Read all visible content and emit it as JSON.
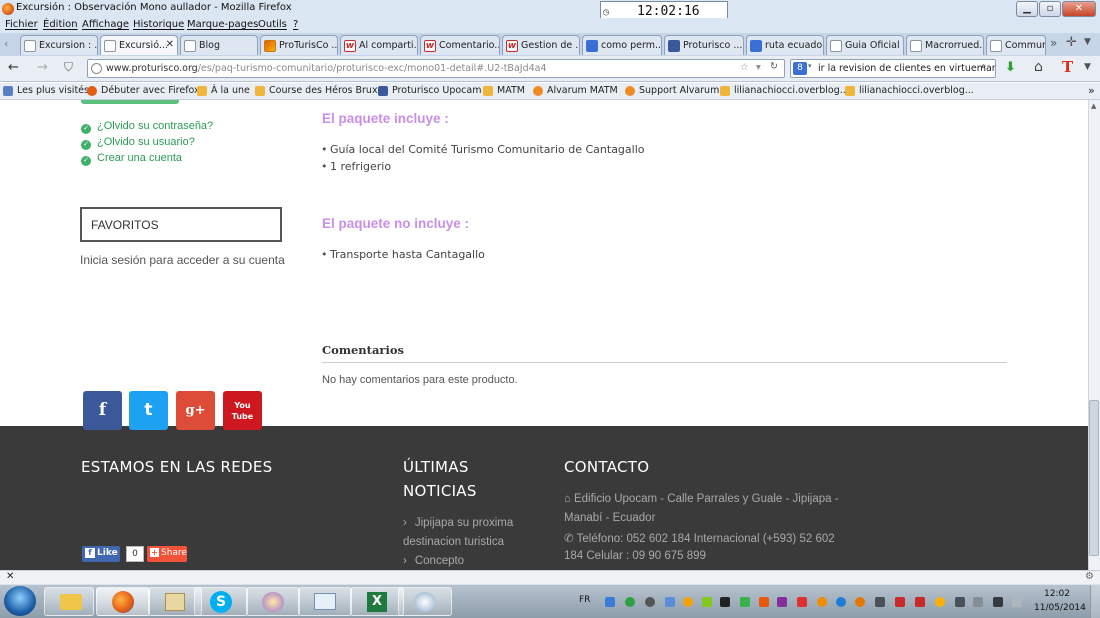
{
  "window": {
    "title": "Excursión : Observación Mono aullador - Mozilla Firefox",
    "clock": "12:02:16"
  },
  "menu": [
    "Fichier",
    "Édition",
    "Affichage",
    "Historique",
    "Marque-pages",
    "Outils",
    "?"
  ],
  "tabs": [
    {
      "label": "Excursion : ...",
      "icon": "page-icon"
    },
    {
      "label": "Excursió...",
      "icon": "page-icon",
      "active": true
    },
    {
      "label": "Blog",
      "icon": "page-icon"
    },
    {
      "label": "ProTurisCo ...",
      "icon": "proturisco-icon"
    },
    {
      "label": "Al comparti...",
      "icon": "w-icon"
    },
    {
      "label": "Comentario...",
      "icon": "w-icon"
    },
    {
      "label": "Gestion de ...",
      "icon": "w-icon"
    },
    {
      "label": "como perm...",
      "icon": "google-icon"
    },
    {
      "label": "Proturisco ...",
      "icon": "facebook-icon"
    },
    {
      "label": "ruta ecuado...",
      "icon": "google-icon"
    },
    {
      "label": "Guia Oficial ...",
      "icon": "page-icon"
    },
    {
      "label": "Macrorrued...",
      "icon": "page-icon"
    },
    {
      "label": "Communi...",
      "icon": "page-icon"
    }
  ],
  "nav": {
    "url_host": "www.proturisco.org",
    "url_path": "/es/paq-turismo-comunitario/proturisco-exc/mono01-detail#.U2-tBaJd4a4",
    "search": "ir la revision de clientes en virtuemart"
  },
  "bookmarks": [
    "Les plus visités",
    "Débuter avec Firefox",
    "À la une",
    "Course des Héros Brux...",
    "Proturisco Upocam",
    "MATM",
    "Alvarum MATM",
    "Support Alvarum",
    "lilianachiocci.overblog...",
    "lilianachiocci.overblog..."
  ],
  "sidebar": {
    "links": [
      "¿Olvido su contraseña?",
      "¿Olvido su usuario?",
      "Crear una cuenta"
    ],
    "favorites_title": "FAVORITOS",
    "favorites_text": "Inicia sesión para acceder a su cuenta"
  },
  "main": {
    "includes_title": "El paquete incluye :",
    "includes": [
      "Guía local del Comité Turismo Comunitario de Cantagallo",
      "1 refrigerio"
    ],
    "excludes_title": "El paquete no incluye :",
    "excludes": [
      "Transporte hasta Cantagallo"
    ],
    "comments_title": "Comentarios",
    "comments_text": "No hay comentarios para este producto."
  },
  "footer": {
    "social_title": "ESTAMOS EN LAS REDES",
    "social": [
      {
        "glyph": "f",
        "color": "#3b5998"
      },
      {
        "glyph": "t",
        "color": "#1da1f2"
      },
      {
        "glyph": "g+",
        "color": "#dd4b39"
      },
      {
        "glyph": "You Tube",
        "color": "#cc181e"
      }
    ],
    "like_label": "Like",
    "like_count": "0",
    "share_label": "Share",
    "news_title_1": "ÚLTIMAS",
    "news_title_2": "NOTICIAS",
    "news": [
      "Jipijapa su proxima",
      "destinacion turistica",
      "Concepto"
    ],
    "contact_title": "CONTACTO",
    "contact_address_1": "Edificio Upocam - Calle Parrales y Guale - Jipijapa -",
    "contact_address_2": "Manabí - Ecuador",
    "contact_phone_1": "Teléfono:  052 602 184  Internacional (+593) 52 602",
    "contact_phone_2": "184   Celular : 09 90 675 899"
  },
  "taskbar": {
    "lang": "FR",
    "time": "12:02",
    "date": "11/05/2014"
  }
}
